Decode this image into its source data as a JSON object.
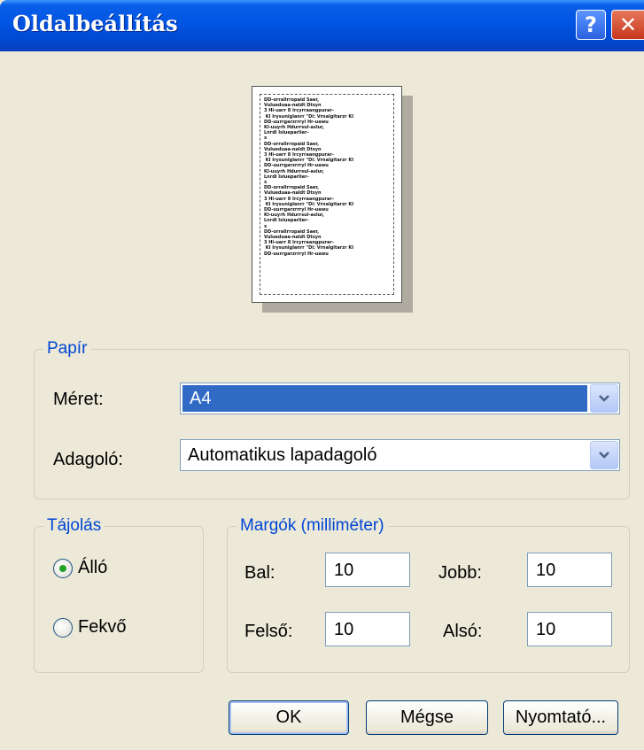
{
  "window": {
    "title": "Oldalbeállítás",
    "help_label": "?",
    "close_label": "✕"
  },
  "preview": {
    "lines": [
      "DD-orrallrropaid Saer,",
      "Vulueduaa-naldt Dtsyn",
      "3 Hi-uarr 8 Ircyrraangpurar-",
      " KI Irysuniglanrr \"Di: Vrnalgitarzr KI",
      "DD-uurrgarzrrryl Hr-uawu",
      "KI-uuyrh Hdurrsul-aslur,",
      "Lnrdl Islueparlier-",
      "x",
      "DD-orrallrropaid Saer,",
      "Vulueduaa-naldt Dtsyn",
      "3 Hi-uarr 8 Ircyrraangpurar-",
      " KI Irysuniglanrr \"Di: Vrnalgitarzr KI",
      "DD-uurrgarzrrryl Hr-uawu",
      "KI-uuyrh Hdurrsul-aslur,",
      "Lnrdl Islueparlier-",
      "x",
      "DD-orrallrropaid Saer,",
      "Vulueduaa-naldt Dtsyn",
      "3 Hi-uarr 8 Ircyrraangpurar-",
      " KI Irysuniglanrr \"Di: Vrnalgitarzr KI",
      "DD-uurrgarzrrryl Hr-uawu",
      "KI-uuyrh Hdurrsul-aslur,",
      "Lnrdl Islueparlier-",
      "x",
      "DD-orrallrropaid Saer,",
      "Vulueduaa-naldt Dtsyn",
      "3 Hi-uarr 8 Ircyrraangpurar-",
      " KI Irysuniglanrr \"Di: Vrnalgitarzr KI",
      "DD-uurrgarzrrryl Hr-uawu"
    ]
  },
  "paper": {
    "legend": "Papír",
    "size_label": "Méret:",
    "size_value": "A4",
    "source_label": "Adagoló:",
    "source_value": "Automatikus lapadagoló"
  },
  "orientation": {
    "legend": "Tájolás",
    "portrait_label": "Álló",
    "landscape_label": "Fekvő",
    "selected": "portrait"
  },
  "margins": {
    "legend": "Margók (milliméter)",
    "left_label": "Bal:",
    "left_value": "10",
    "right_label": "Jobb:",
    "right_value": "10",
    "top_label": "Felső:",
    "top_value": "10",
    "bottom_label": "Alsó:",
    "bottom_value": "10"
  },
  "buttons": {
    "ok": "OK",
    "cancel": "Mégse",
    "printer": "Nyomtató..."
  },
  "colors": {
    "titlebar": "#0054e3",
    "accent": "#0046d5",
    "selection": "#316ac5",
    "dialog_bg": "#ece9d8"
  },
  "icons": {
    "help": "help-icon",
    "close": "close-icon",
    "dropdown": "chevron-down-icon"
  }
}
